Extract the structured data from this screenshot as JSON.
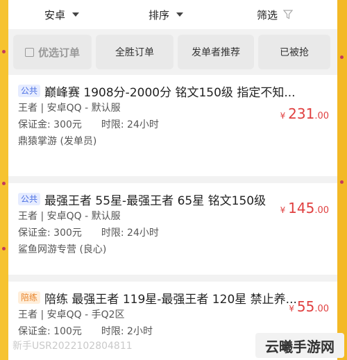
{
  "filterbar": {
    "android": "安卓",
    "sort": "排序",
    "filter": "筛选"
  },
  "tabs": [
    "优选订单",
    "全胜订单",
    "发单者推荐",
    "已被抢"
  ],
  "orders": [
    {
      "tag": "公共",
      "title": "巅峰赛 1908分-2000分 铭文150级 指定不知...",
      "game": "王者 | 安卓QQ - 默认服",
      "deposit": "保证金: 300元",
      "time": "时限: 24小时",
      "publisher": "鼎猿掌游 (发单员)",
      "yen": "¥",
      "price_int": "231",
      "price_dec": ".00"
    },
    {
      "tag": "公共",
      "title": "最强王者 55星-最强王者 65星 铭文150级",
      "game": "王者 | 安卓QQ - 默认服",
      "deposit": "保证金: 300元",
      "time": "时限: 24小时",
      "publisher": "鲨鱼网游专营 (良心)",
      "yen": "¥",
      "price_int": "145",
      "price_dec": ".00"
    },
    {
      "tag": "陪练",
      "title": "陪练 最强王者 119星-最强王者 120星 禁止养...",
      "game": "王者 | 安卓QQ - 手Q2区",
      "deposit": "保证金: 100元",
      "time": "时限: 2小时",
      "yen": "¥",
      "price_int": "55",
      "price_dec": ".00"
    }
  ],
  "watermark": {
    "user": "新手USR2022102804811",
    "logo": "云曦手游网"
  }
}
